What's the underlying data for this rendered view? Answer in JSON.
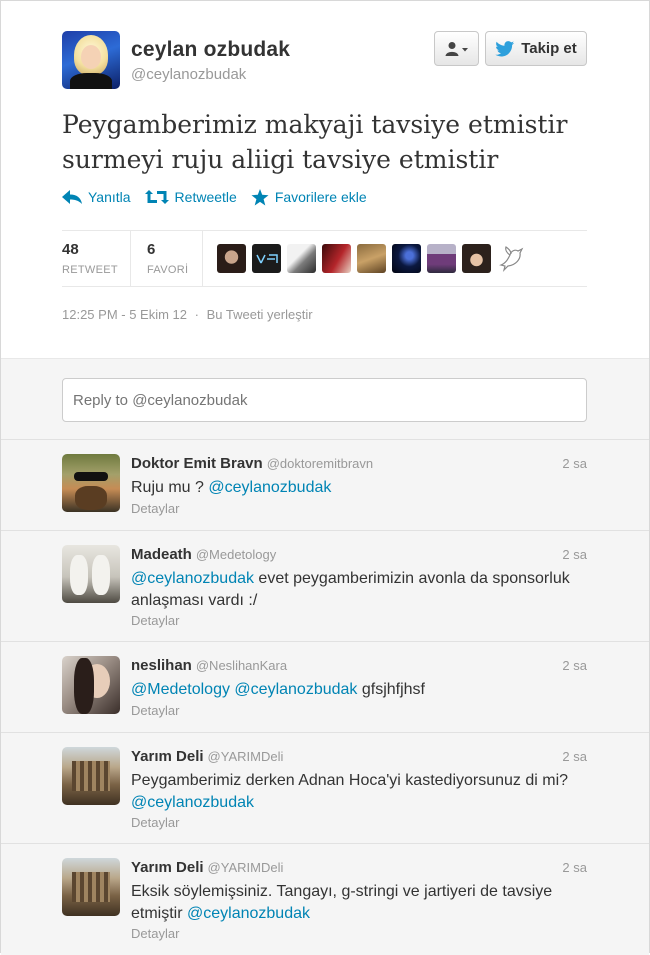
{
  "tweet": {
    "author_name": "ceylan ozbudak",
    "author_handle": "@ceylanozbudak",
    "follow_label": "Takip et",
    "text_line1": "Peygamberimiz makyaji tavsiye etmistir",
    "text_line2": "surmeyi ruju aliigi tavsiye etmistir",
    "actions": {
      "reply": "Yanıtla",
      "retweet": "Retweetle",
      "favorite": "Favorilere ekle"
    },
    "retweet_count": "48",
    "retweet_label": "RETWEET",
    "favorite_count": "6",
    "favorite_label": "FAVORİ",
    "timestamp": "12:25 PM - 5 Ekim 12",
    "separator": "·",
    "embed_label": "Bu Tweeti yerleştir"
  },
  "reply_box": {
    "placeholder": "Reply to @ceylanozbudak"
  },
  "replies": [
    {
      "name": "Doktor Emit Bravn",
      "handle": "@doktoremitbravn",
      "time": "2 sa",
      "text_plain": "Ruju mu ? ",
      "mention1": "@ceylanozbudak",
      "detail": "Detaylar"
    },
    {
      "name": "Madeath",
      "handle": "@Medetology",
      "time": "2 sa",
      "mention1": "@ceylanozbudak",
      "text_plain": " evet peygamberimizin avonla da sponsorluk anlaşması vardı :/",
      "detail": "Detaylar"
    },
    {
      "name": "neslihan",
      "handle": "@NeslihanKara",
      "time": "2 sa",
      "mention1": "@Medetology",
      "mention2": "@ceylanozbudak",
      "text_plain": " gfsjhfjhsf",
      "detail": "Detaylar"
    },
    {
      "name": "Yarım Deli",
      "handle": "@YARIMDeli",
      "time": "2 sa",
      "text_plain": "Peygamberimiz derken Adnan Hoca'yi kastediyorsunuz di mi? ",
      "mention1": "@ceylanozbudak",
      "detail": "Detaylar"
    },
    {
      "name": "Yarım Deli",
      "handle": "@YARIMDeli",
      "time": "2 sa",
      "text_plain": "Eksik söylemişsiniz. Tangayı, g-stringi ve jartiyeri de tavsiye etmiştir ",
      "mention1": "@ceylanozbudak",
      "detail": "Detaylar"
    }
  ],
  "colors": {
    "link": "#0084b4",
    "text": "#333333",
    "muted": "#999999",
    "panel_bg": "#f5f5f5"
  }
}
